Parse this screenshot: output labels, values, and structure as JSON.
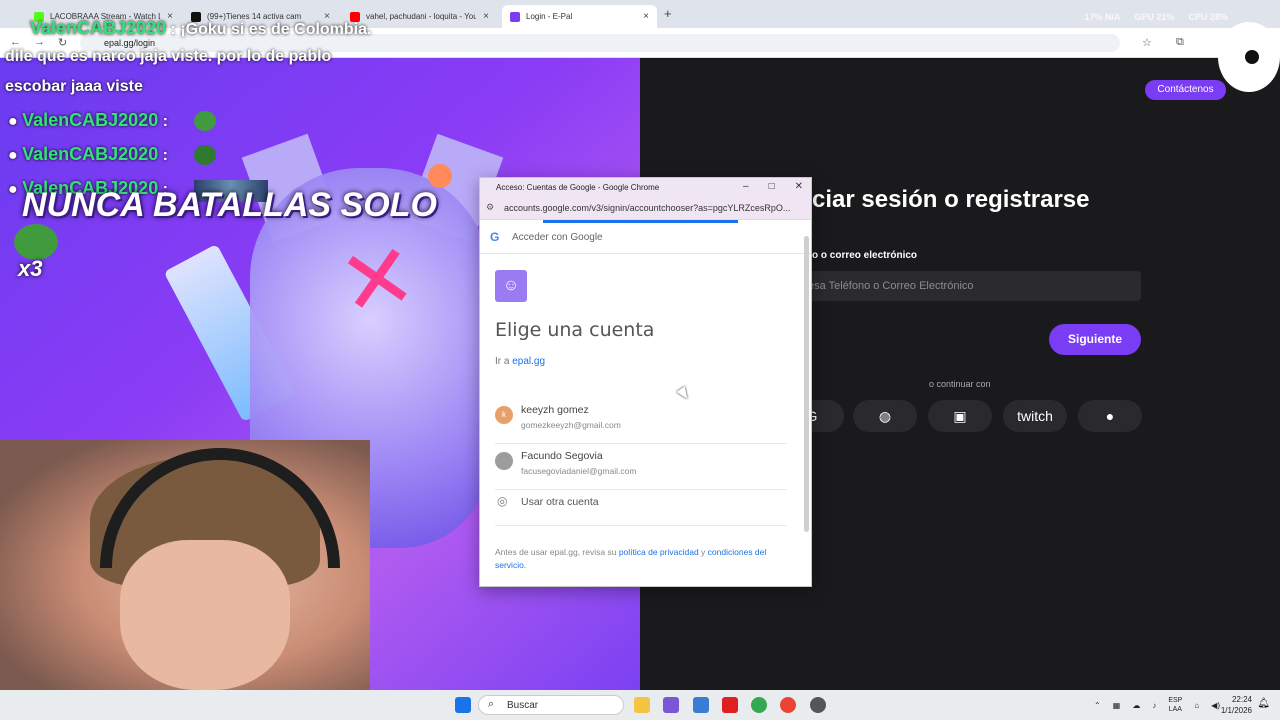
{
  "browser": {
    "tabs": [
      {
        "title": "LACOBRAAA Stream - Watch L",
        "color": "#53fc18"
      },
      {
        "title": "(99+)Tienes 14 activa cam",
        "color": "#111111"
      },
      {
        "title": "vahel, pachudani - loquita - You",
        "color": "#ff0000"
      },
      {
        "title": "Login - E-Pal",
        "color": "#7b3cf5"
      }
    ],
    "address": "epal.gg/login",
    "stats": [
      "17% N/A",
      "GPU 21%",
      "CPU 28%"
    ]
  },
  "page": {
    "contact_label": "Contáctenos",
    "title": "ciar sesión o registrarse",
    "field_label": "o o correo electrónico",
    "field_placeholder": "esa Teléfono o Correo Electrónico",
    "next_label": "Siguiente",
    "or_text": "o continuar con",
    "social": [
      "G",
      "discord",
      "twitch",
      "f",
      "apple"
    ]
  },
  "popup": {
    "window_title": "Acceso: Cuentas de Google - Google Chrome",
    "url": "accounts.google.com/v3/signin/accountchooser?as=pgcYLRZcesRpO...",
    "signin_with": "Acceder con Google",
    "heading": "Elige una cuenta",
    "goto_prefix": "Ir a",
    "goto_site": "epal.gg",
    "accounts": [
      {
        "initial": "k",
        "name": "keeyzh gomez",
        "email": "gomezkeeyzh@gmail.com",
        "color": "#e8a06a"
      },
      {
        "initial": "",
        "name": "Facundo Segovia",
        "email": "facusegoviadaniel@gmail.com",
        "color": "#9c9c9c"
      }
    ],
    "other_account": "Usar otra cuenta",
    "legal_prefix": "Antes de usar epal.gg, revisa su",
    "privacy": "política de privacidad",
    "legal_and": "y",
    "terms": "condiciones del servicio."
  },
  "overlay": {
    "chat": [
      {
        "name": "ValenCABJ2020",
        "text": ": ¡Goku si es de Colombia."
      },
      {
        "name": "",
        "text": "dile que es narco jaja viste. por lo de pablo"
      },
      {
        "name": "",
        "text": "escobar jaaa viste"
      },
      {
        "name": "ValenCABJ2020",
        "text": ":"
      },
      {
        "name": "ValenCABJ2020",
        "text": ":"
      },
      {
        "name": "ValenCABJ2020",
        "text": ":"
      }
    ],
    "banner": "NUNCA BATALLAS SOLO",
    "multiplier": "x3"
  },
  "taskbar": {
    "search": "Buscar",
    "lang": [
      "ESP",
      "LAA"
    ],
    "time": "22:24",
    "date": "1/1/2026"
  }
}
